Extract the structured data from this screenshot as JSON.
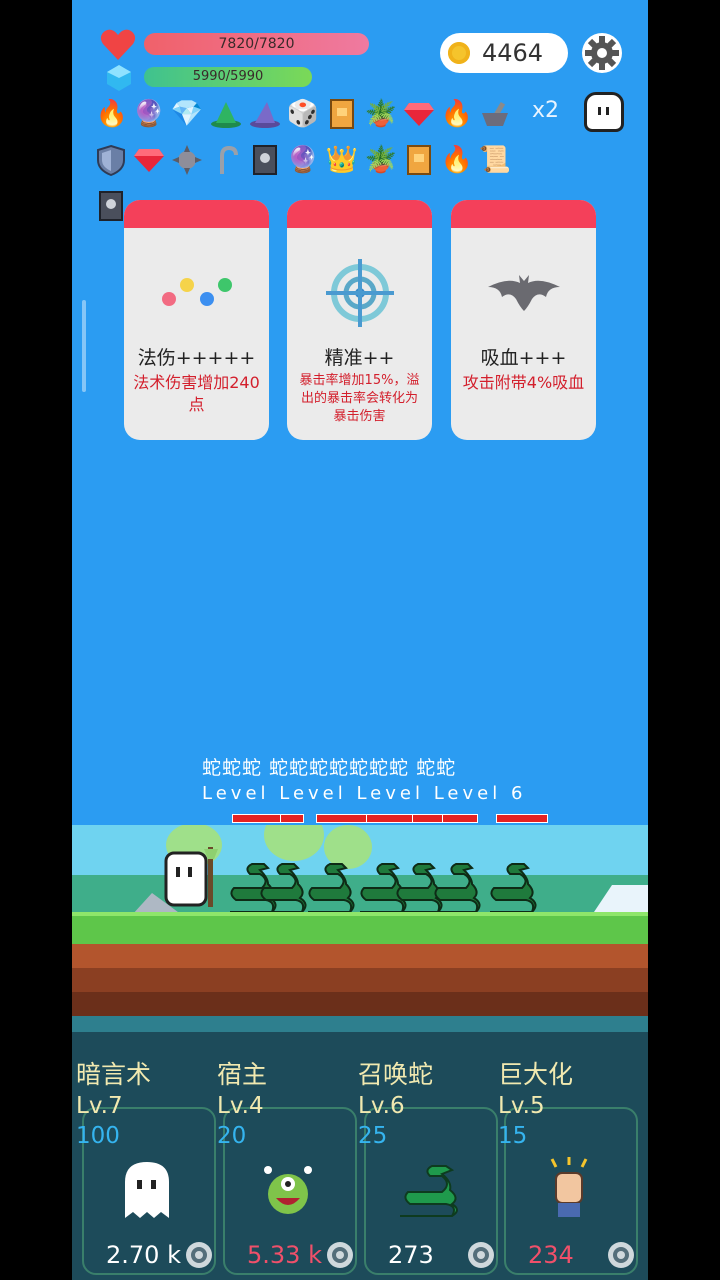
{
  "hud": {
    "hp_text": "7820/7820",
    "mp_text": "5990/5990",
    "coins": "4464",
    "multiplier": "x2"
  },
  "inventory_row1": [
    "torch-icon",
    "crystal-ball-icon",
    "diamond-icon",
    "green-hat-icon",
    "wizard-hat-icon",
    "dice-icon",
    "gold-book-icon",
    "plant-icon",
    "ruby-icon",
    "torch-icon",
    "mortar-icon"
  ],
  "inventory_row2": [
    "shield-icon",
    "ruby-icon",
    "spiked-ball-icon",
    "hook-icon",
    "skull-book-icon",
    "crystal-ball-icon",
    "crown-icon",
    "plant-icon",
    "gold-book-icon",
    "torch-icon",
    "scroll-icon"
  ],
  "inventory_row3": [
    "skull-book-icon"
  ],
  "cards": [
    {
      "title": "法伤+++++",
      "desc": "法术伤害增加240点"
    },
    {
      "title": "精准++",
      "desc": "暴击率增加15%，溢出的暴击率会转化为暴击伤害"
    },
    {
      "title": "吸血+++",
      "desc": "攻击附带4%吸血"
    }
  ],
  "battle": {
    "enemy_names": "蛇蛇蛇 蛇蛇蛇蛇蛇蛇蛇  蛇蛇",
    "enemy_levels": "Level Level Level Level 6",
    "enemy_count": 7
  },
  "skills": [
    {
      "name": "暗言术",
      "level": "Lv.7",
      "cost": "100",
      "dps": "2.70 k",
      "dps_color": "#ffffff",
      "icon": "ghost-icon"
    },
    {
      "name": "宿主",
      "level": "Lv.4",
      "cost": "20",
      "dps": "5.33 k",
      "dps_color": "#f0506a",
      "icon": "monster-icon"
    },
    {
      "name": "召唤蛇",
      "level": "Lv.6",
      "cost": "25",
      "dps": "273",
      "dps_color": "#ffffff",
      "icon": "snake-icon"
    },
    {
      "name": "巨大化",
      "level": "Lv.5",
      "cost": "15",
      "dps": "234",
      "dps_color": "#f0506a",
      "icon": "fist-icon"
    }
  ]
}
